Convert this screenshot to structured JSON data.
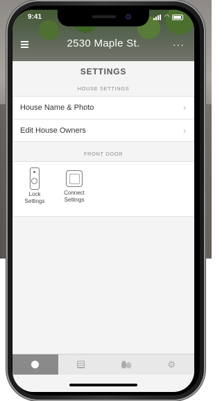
{
  "status_bar": {
    "time": "9:41"
  },
  "header": {
    "house_name": "2530 Maple St.",
    "more_glyph": "···"
  },
  "page": {
    "title": "SETTINGS"
  },
  "house_settings": {
    "section_label": "HOUSE SETTINGS",
    "rows": [
      {
        "label": "House Name & Photo"
      },
      {
        "label": "Edit House Owners"
      }
    ]
  },
  "front_door": {
    "section_label": "FRONT DOOR",
    "tiles": [
      {
        "label_line1": "Lock",
        "label_line2": "Settings",
        "icon": "smart-lock-icon"
      },
      {
        "label_line1": "Connect",
        "label_line2": "Settings",
        "icon": "connect-bridge-icon"
      }
    ]
  },
  "tabs": [
    {
      "icon": "home-dot-icon",
      "active": true
    },
    {
      "icon": "activity-list-icon",
      "active": false
    },
    {
      "icon": "guests-icon",
      "active": false
    },
    {
      "icon": "settings-gear-icon",
      "active": false
    }
  ],
  "colors": {
    "active_tab": "#8a8a8a",
    "tab_bar": "#e8e8e8",
    "background": "#f4f4f4"
  }
}
